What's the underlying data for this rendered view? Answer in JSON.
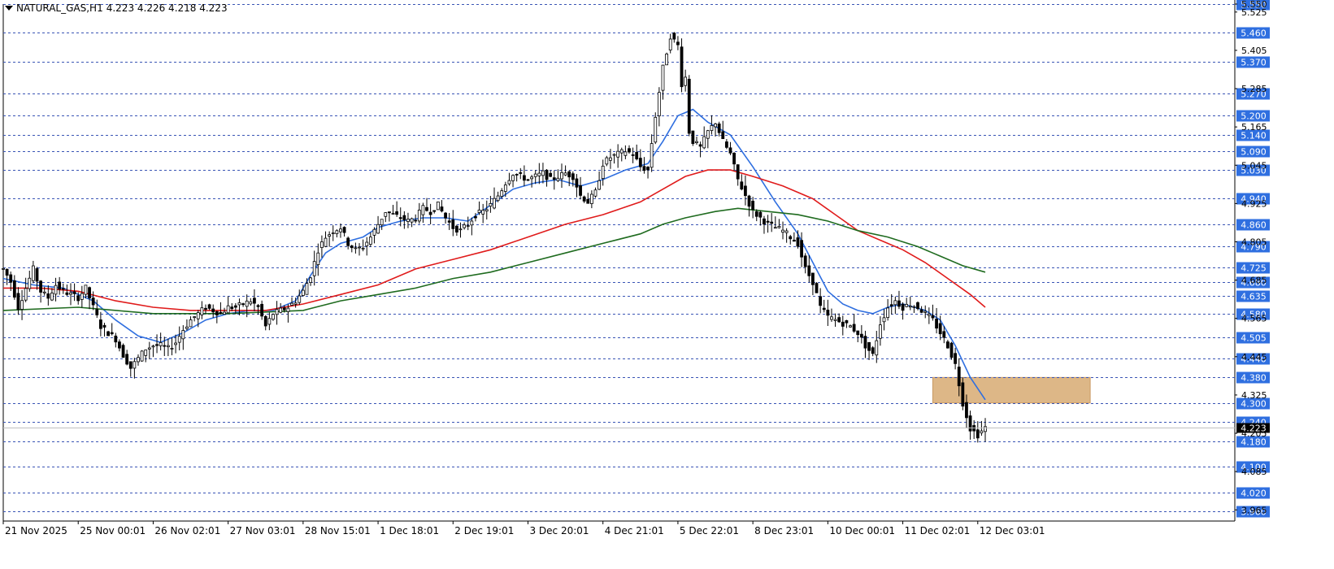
{
  "window": {
    "symbol": "NATURAL_GAS,H1",
    "ohlc": "4.223 4.226 4.218 4.223"
  },
  "colors": {
    "background": "#ffffff",
    "grid": "#3a55b5",
    "candles": "#000000",
    "ma_fast": "#2f6fe0",
    "ma_mid": "#e01b1b",
    "ma_slow": "#1f6b1f",
    "zone": "#ddb787",
    "level_label_bg": "#2f6fe0",
    "current_price_bg": "#000000"
  },
  "chart_data": {
    "type": "line",
    "symbol": "NATURAL_GAS",
    "timeframe": "H1",
    "last_ohlc": [
      4.223,
      4.226,
      4.218,
      4.223
    ],
    "current_price": 4.223,
    "ylim": [
      3.93,
      5.55
    ],
    "grid": true,
    "x_range_bars": [
      0,
      262
    ],
    "axis_ticks": [
      "5.550",
      "5.525",
      "5.405",
      "5.285",
      "5.165",
      "5.045",
      "4.925",
      "4.805",
      "4.685",
      "4.565",
      "4.445",
      "4.325",
      "4.205",
      "4.085",
      "3.965"
    ],
    "axis_tick_values": [
      5.55,
      5.525,
      5.405,
      5.285,
      5.165,
      5.045,
      4.925,
      4.805,
      4.685,
      4.565,
      4.445,
      4.325,
      4.205,
      4.085,
      3.965
    ],
    "x_tick_labels": [
      {
        "label": "21 Nov 2025",
        "bar": 0
      },
      {
        "label": "25 Nov 00:01",
        "bar": 20
      },
      {
        "label": "26 Nov 02:01",
        "bar": 40
      },
      {
        "label": "27 Nov 03:01",
        "bar": 60
      },
      {
        "label": "28 Nov 15:01",
        "bar": 80
      },
      {
        "label": "1 Dec 18:01",
        "bar": 100
      },
      {
        "label": "2 Dec 19:01",
        "bar": 120
      },
      {
        "label": "3 Dec 20:01",
        "bar": 140
      },
      {
        "label": "4 Dec 21:01",
        "bar": 160
      },
      {
        "label": "5 Dec 22:01",
        "bar": 180
      },
      {
        "label": "8 Dec 23:01",
        "bar": 200
      },
      {
        "label": "10 Dec 00:01",
        "bar": 220
      },
      {
        "label": "11 Dec 02:01",
        "bar": 240
      },
      {
        "label": "12 Dec 03:01",
        "bar": 260
      }
    ],
    "levels": [
      "5.550",
      "5.460",
      "5.370",
      "5.270",
      "5.200",
      "5.140",
      "5.090",
      "5.030",
      "4.940",
      "4.860",
      "4.790",
      "4.725",
      "4.680",
      "4.635",
      "4.580",
      "4.505",
      "4.440",
      "4.380",
      "4.300",
      "4.240",
      "4.180",
      "4.100",
      "4.020",
      "3.960"
    ],
    "zone": {
      "bar_start": 248,
      "bar_end": 290,
      "price_low": 4.3,
      "price_high": 4.38
    },
    "price_path": [
      [
        0,
        4.72
      ],
      [
        2,
        4.68
      ],
      [
        4,
        4.6
      ],
      [
        6,
        4.66
      ],
      [
        8,
        4.72
      ],
      [
        10,
        4.65
      ],
      [
        12,
        4.63
      ],
      [
        14,
        4.67
      ],
      [
        16,
        4.65
      ],
      [
        18,
        4.64
      ],
      [
        20,
        4.63
      ],
      [
        22,
        4.66
      ],
      [
        24,
        4.6
      ],
      [
        26,
        4.54
      ],
      [
        28,
        4.52
      ],
      [
        30,
        4.5
      ],
      [
        32,
        4.45
      ],
      [
        34,
        4.41
      ],
      [
        36,
        4.44
      ],
      [
        38,
        4.47
      ],
      [
        40,
        4.48
      ],
      [
        42,
        4.48
      ],
      [
        44,
        4.47
      ],
      [
        46,
        4.49
      ],
      [
        48,
        4.53
      ],
      [
        50,
        4.56
      ],
      [
        52,
        4.58
      ],
      [
        54,
        4.6
      ],
      [
        56,
        4.59
      ],
      [
        58,
        4.58
      ],
      [
        60,
        4.6
      ],
      [
        62,
        4.6
      ],
      [
        64,
        4.61
      ],
      [
        66,
        4.62
      ],
      [
        68,
        4.6
      ],
      [
        70,
        4.54
      ],
      [
        72,
        4.58
      ],
      [
        74,
        4.59
      ],
      [
        76,
        4.6
      ],
      [
        78,
        4.62
      ],
      [
        80,
        4.65
      ],
      [
        82,
        4.7
      ],
      [
        84,
        4.78
      ],
      [
        86,
        4.82
      ],
      [
        88,
        4.84
      ],
      [
        90,
        4.85
      ],
      [
        92,
        4.8
      ],
      [
        94,
        4.78
      ],
      [
        96,
        4.79
      ],
      [
        98,
        4.82
      ],
      [
        100,
        4.86
      ],
      [
        102,
        4.9
      ],
      [
        104,
        4.89
      ],
      [
        106,
        4.88
      ],
      [
        108,
        4.87
      ],
      [
        110,
        4.88
      ],
      [
        112,
        4.91
      ],
      [
        114,
        4.9
      ],
      [
        116,
        4.92
      ],
      [
        118,
        4.88
      ],
      [
        120,
        4.85
      ],
      [
        122,
        4.84
      ],
      [
        124,
        4.86
      ],
      [
        126,
        4.89
      ],
      [
        128,
        4.9
      ],
      [
        130,
        4.92
      ],
      [
        132,
        4.95
      ],
      [
        134,
        4.99
      ],
      [
        136,
        5.02
      ],
      [
        138,
        5.01
      ],
      [
        140,
        5.0
      ],
      [
        142,
        5.01
      ],
      [
        144,
        5.02
      ],
      [
        146,
        5.0
      ],
      [
        148,
        5.01
      ],
      [
        150,
        5.02
      ],
      [
        152,
        5.01
      ],
      [
        154,
        4.95
      ],
      [
        156,
        4.93
      ],
      [
        158,
        4.96
      ],
      [
        160,
        5.05
      ],
      [
        162,
        5.07
      ],
      [
        164,
        5.08
      ],
      [
        166,
        5.09
      ],
      [
        168,
        5.08
      ],
      [
        170,
        5.04
      ],
      [
        172,
        5.03
      ],
      [
        174,
        5.2
      ],
      [
        176,
        5.35
      ],
      [
        178,
        5.45
      ],
      [
        180,
        5.42
      ],
      [
        181,
        5.3
      ],
      [
        182,
        5.32
      ],
      [
        183,
        5.15
      ],
      [
        184,
        5.12
      ],
      [
        186,
        5.1
      ],
      [
        188,
        5.15
      ],
      [
        190,
        5.18
      ],
      [
        192,
        5.12
      ],
      [
        194,
        5.08
      ],
      [
        196,
        5.0
      ],
      [
        198,
        4.95
      ],
      [
        200,
        4.9
      ],
      [
        202,
        4.88
      ],
      [
        204,
        4.86
      ],
      [
        206,
        4.85
      ],
      [
        208,
        4.84
      ],
      [
        210,
        4.82
      ],
      [
        212,
        4.8
      ],
      [
        214,
        4.72
      ],
      [
        216,
        4.68
      ],
      [
        218,
        4.6
      ],
      [
        220,
        4.57
      ],
      [
        222,
        4.56
      ],
      [
        224,
        4.55
      ],
      [
        226,
        4.54
      ],
      [
        228,
        4.52
      ],
      [
        230,
        4.48
      ],
      [
        232,
        4.45
      ],
      [
        234,
        4.55
      ],
      [
        236,
        4.6
      ],
      [
        238,
        4.62
      ],
      [
        240,
        4.6
      ],
      [
        242,
        4.61
      ],
      [
        244,
        4.6
      ],
      [
        246,
        4.58
      ],
      [
        248,
        4.56
      ],
      [
        250,
        4.52
      ],
      [
        252,
        4.48
      ],
      [
        254,
        4.42
      ],
      [
        256,
        4.3
      ],
      [
        258,
        4.22
      ],
      [
        260,
        4.2
      ],
      [
        262,
        4.223
      ]
    ],
    "series": [
      {
        "color_key": "ma_fast",
        "points": [
          [
            0,
            4.69
          ],
          [
            8,
            4.67
          ],
          [
            16,
            4.66
          ],
          [
            24,
            4.62
          ],
          [
            30,
            4.56
          ],
          [
            36,
            4.51
          ],
          [
            42,
            4.49
          ],
          [
            48,
            4.52
          ],
          [
            54,
            4.56
          ],
          [
            60,
            4.58
          ],
          [
            66,
            4.59
          ],
          [
            72,
            4.59
          ],
          [
            78,
            4.62
          ],
          [
            82,
            4.7
          ],
          [
            86,
            4.77
          ],
          [
            90,
            4.8
          ],
          [
            96,
            4.82
          ],
          [
            100,
            4.85
          ],
          [
            106,
            4.87
          ],
          [
            112,
            4.88
          ],
          [
            118,
            4.88
          ],
          [
            124,
            4.87
          ],
          [
            130,
            4.92
          ],
          [
            136,
            4.97
          ],
          [
            142,
            4.99
          ],
          [
            148,
            5.0
          ],
          [
            154,
            4.98
          ],
          [
            160,
            5.0
          ],
          [
            166,
            5.03
          ],
          [
            172,
            5.05
          ],
          [
            176,
            5.12
          ],
          [
            180,
            5.2
          ],
          [
            184,
            5.22
          ],
          [
            188,
            5.18
          ],
          [
            194,
            5.14
          ],
          [
            200,
            5.04
          ],
          [
            206,
            4.93
          ],
          [
            212,
            4.83
          ],
          [
            216,
            4.74
          ],
          [
            220,
            4.65
          ],
          [
            224,
            4.61
          ],
          [
            228,
            4.59
          ],
          [
            232,
            4.58
          ],
          [
            236,
            4.6
          ],
          [
            240,
            4.61
          ],
          [
            246,
            4.59
          ],
          [
            250,
            4.56
          ],
          [
            254,
            4.48
          ],
          [
            258,
            4.38
          ],
          [
            262,
            4.31
          ]
        ]
      },
      {
        "color_key": "ma_mid",
        "points": [
          [
            0,
            4.66
          ],
          [
            10,
            4.66
          ],
          [
            20,
            4.65
          ],
          [
            30,
            4.62
          ],
          [
            40,
            4.6
          ],
          [
            50,
            4.59
          ],
          [
            60,
            4.59
          ],
          [
            70,
            4.59
          ],
          [
            80,
            4.61
          ],
          [
            90,
            4.64
          ],
          [
            100,
            4.67
          ],
          [
            110,
            4.72
          ],
          [
            120,
            4.75
          ],
          [
            130,
            4.78
          ],
          [
            140,
            4.82
          ],
          [
            150,
            4.86
          ],
          [
            160,
            4.89
          ],
          [
            170,
            4.93
          ],
          [
            176,
            4.97
          ],
          [
            182,
            5.01
          ],
          [
            188,
            5.03
          ],
          [
            194,
            5.03
          ],
          [
            200,
            5.01
          ],
          [
            208,
            4.98
          ],
          [
            216,
            4.94
          ],
          [
            222,
            4.89
          ],
          [
            228,
            4.84
          ],
          [
            234,
            4.81
          ],
          [
            240,
            4.78
          ],
          [
            246,
            4.74
          ],
          [
            252,
            4.69
          ],
          [
            258,
            4.64
          ],
          [
            262,
            4.6
          ]
        ]
      },
      {
        "color_key": "ma_slow",
        "points": [
          [
            0,
            4.59
          ],
          [
            20,
            4.6
          ],
          [
            40,
            4.58
          ],
          [
            60,
            4.58
          ],
          [
            80,
            4.59
          ],
          [
            90,
            4.62
          ],
          [
            100,
            4.64
          ],
          [
            110,
            4.66
          ],
          [
            120,
            4.69
          ],
          [
            130,
            4.71
          ],
          [
            140,
            4.74
          ],
          [
            150,
            4.77
          ],
          [
            160,
            4.8
          ],
          [
            170,
            4.83
          ],
          [
            176,
            4.86
          ],
          [
            182,
            4.88
          ],
          [
            190,
            4.9
          ],
          [
            196,
            4.91
          ],
          [
            204,
            4.9
          ],
          [
            212,
            4.89
          ],
          [
            220,
            4.87
          ],
          [
            228,
            4.84
          ],
          [
            236,
            4.82
          ],
          [
            244,
            4.79
          ],
          [
            250,
            4.76
          ],
          [
            256,
            4.73
          ],
          [
            262,
            4.71
          ]
        ]
      }
    ]
  }
}
